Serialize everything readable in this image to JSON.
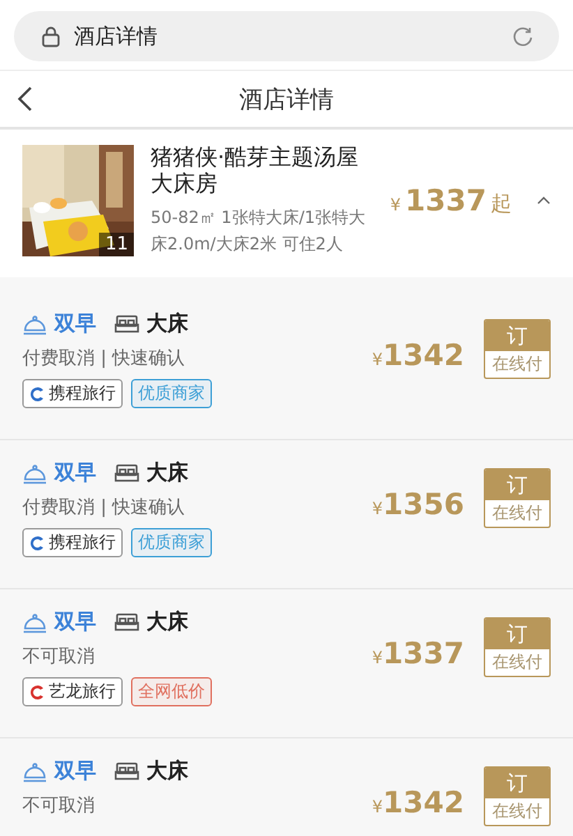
{
  "address_bar": {
    "title": "酒店详情"
  },
  "nav_bar": {
    "title": "酒店详情"
  },
  "room": {
    "name": "猪猪侠·酷芽主题汤屋大床房",
    "details": "50-82㎡  1张特大床/1张特大床2.0m/大床2米  可住2人",
    "photo_count": "11",
    "currency": "¥",
    "price": "1337",
    "suffix": "起",
    "expanded": true
  },
  "offers": [
    {
      "breakfast": "双早",
      "bed": "大床",
      "policy": "付费取消 | 快速确认",
      "currency": "¥",
      "price": "1342",
      "book": "订",
      "payment": "在线付",
      "tags": [
        {
          "kind": "source",
          "label": "携程旅行",
          "color": "#2f6fc9"
        },
        {
          "kind": "badge",
          "label": "优质商家",
          "color": "#3d9fd6"
        }
      ]
    },
    {
      "breakfast": "双早",
      "bed": "大床",
      "policy": "付费取消 | 快速确认",
      "currency": "¥",
      "price": "1356",
      "book": "订",
      "payment": "在线付",
      "tags": [
        {
          "kind": "source",
          "label": "携程旅行",
          "color": "#2f6fc9"
        },
        {
          "kind": "badge",
          "label": "优质商家",
          "color": "#3d9fd6"
        }
      ]
    },
    {
      "breakfast": "双早",
      "bed": "大床",
      "policy": "不可取消",
      "currency": "¥",
      "price": "1337",
      "book": "订",
      "payment": "在线付",
      "tags": [
        {
          "kind": "source",
          "label": "艺龙旅行",
          "color": "#d8322e"
        },
        {
          "kind": "badge",
          "label": "全网低价",
          "color": "#e0705f"
        }
      ]
    },
    {
      "breakfast": "双早",
      "bed": "大床",
      "policy": "不可取消",
      "currency": "¥",
      "price": "1342",
      "book": "订",
      "payment": "在线付"
    }
  ]
}
